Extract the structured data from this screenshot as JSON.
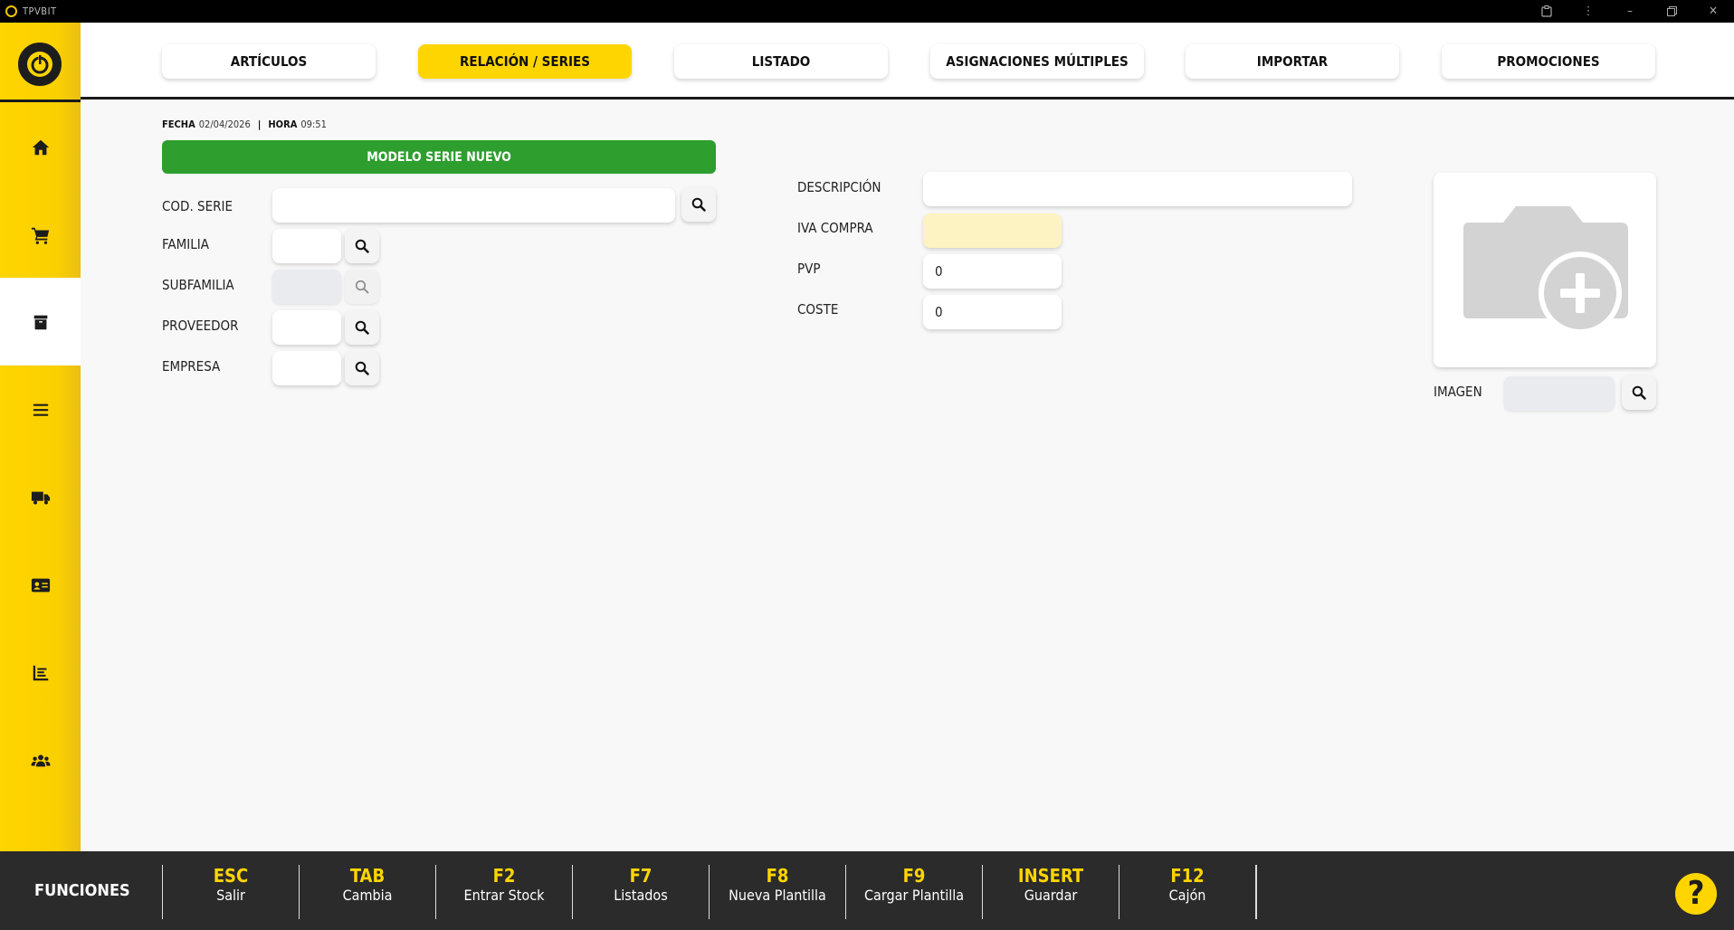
{
  "window": {
    "title": "TPVBIT"
  },
  "tabs": [
    {
      "label": "ARTÍCULOS",
      "active": false
    },
    {
      "label": "RELACIÓN / SERIES",
      "active": true
    },
    {
      "label": "LISTADO",
      "active": false
    },
    {
      "label": "ASIGNACIONES MÚLTIPLES",
      "active": false
    },
    {
      "label": "IMPORTAR",
      "active": false
    },
    {
      "label": "PROMOCIONES",
      "active": false
    }
  ],
  "datetime": {
    "fecha_label": "FECHA",
    "fecha_value": "02/04/2026",
    "separator": "|",
    "hora_label": "HORA",
    "hora_value": "09:51"
  },
  "new_button_label": "MODELO SERIE NUEVO",
  "form": {
    "cod_serie": {
      "label": "COD. SERIE",
      "value": ""
    },
    "familia": {
      "label": "FAMILIA",
      "value": ""
    },
    "subfamilia": {
      "label": "SUBFAMILIA",
      "value": ""
    },
    "proveedor": {
      "label": "PROVEEDOR",
      "value": ""
    },
    "empresa": {
      "label": "EMPRESA",
      "value": ""
    },
    "descripcion": {
      "label": "DESCRIPCIÓN",
      "value": ""
    },
    "iva_compra": {
      "label": "IVA COMPRA",
      "value": ""
    },
    "pvp": {
      "label": "PVP",
      "value": "0"
    },
    "coste": {
      "label": "COSTE",
      "value": "0"
    },
    "imagen": {
      "label": "IMAGEN",
      "value": ""
    }
  },
  "sidebar_icons": [
    "home-icon",
    "cart-icon",
    "box-icon",
    "list-icon",
    "truck-icon",
    "id-card-icon",
    "chart-icon",
    "users-icon"
  ],
  "functions": {
    "title": "FUNCIONES",
    "keys": [
      {
        "key": "ESC",
        "desc": "Salir"
      },
      {
        "key": "TAB",
        "desc": "Cambia"
      },
      {
        "key": "F2",
        "desc": "Entrar Stock"
      },
      {
        "key": "F7",
        "desc": "Listados"
      },
      {
        "key": "F8",
        "desc": "Nueva Plantilla"
      },
      {
        "key": "F9",
        "desc": "Cargar Plantilla"
      },
      {
        "key": "INSERT",
        "desc": "Guardar"
      },
      {
        "key": "F12",
        "desc": "Cajón"
      }
    ]
  },
  "help_label": "?",
  "colors": {
    "accent": "#ffd500",
    "green": "#2e9e2e",
    "dark": "#2b2b2b"
  }
}
